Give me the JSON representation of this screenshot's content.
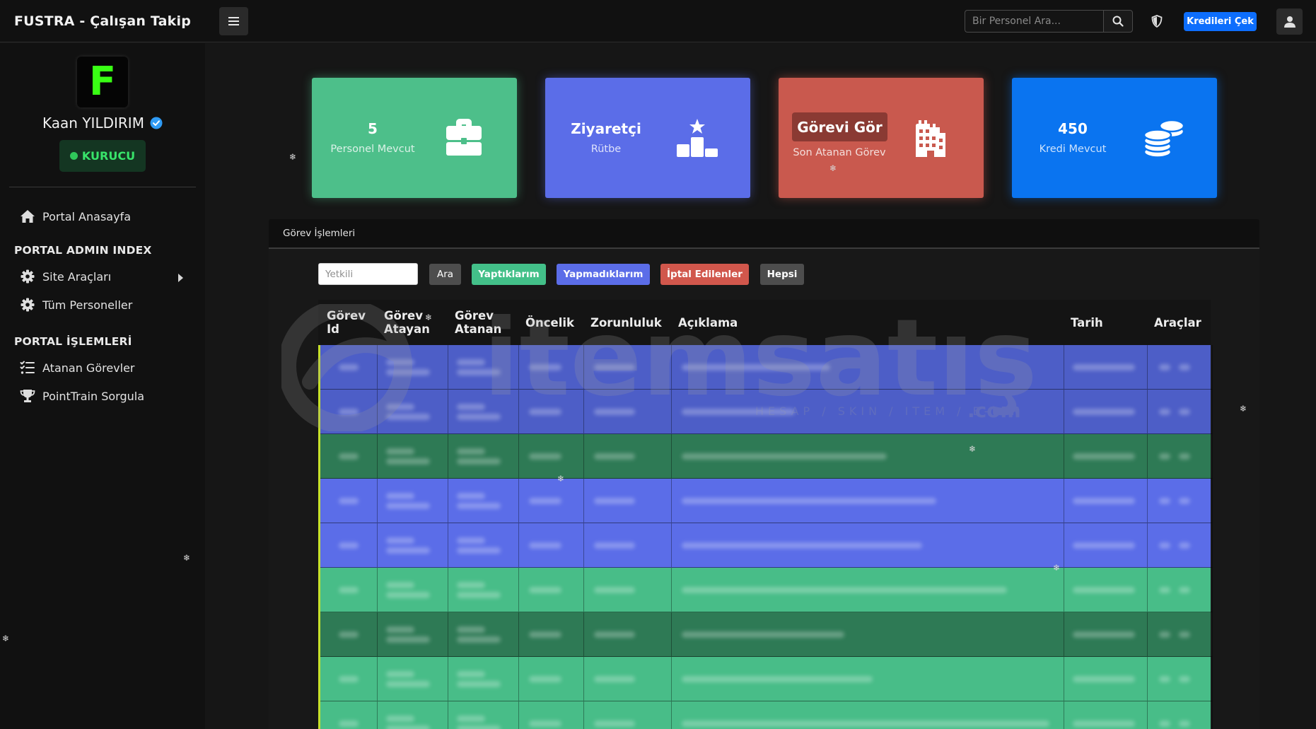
{
  "app": {
    "title": "FUSTRA - Çalışan Takip"
  },
  "topbar": {
    "search_placeholder": "Bir Personel Ara...",
    "credit_button": "Kredileri Çek",
    "icons": [
      "menu-icon",
      "search-icon",
      "shield-icon",
      "user-icon"
    ]
  },
  "sidebar": {
    "logo_letter": "F",
    "user_name": "Kaan YILDIRIM",
    "role": "KURUCU",
    "items": [
      {
        "label": "Portal Anasayfa",
        "icon": "home-icon"
      },
      {
        "heading": "PORTAL ADMIN INDEX"
      },
      {
        "label": "Site Araçları",
        "icon": "gear-icon"
      },
      {
        "label": "Tüm Personeller",
        "icon": "gear-icon"
      },
      {
        "heading": "PORTAL İŞLEMLERİ"
      },
      {
        "label": "Atanan Görevler",
        "icon": "list-check-icon"
      },
      {
        "label": "PointTrain Sorgula",
        "icon": "trophy-icon"
      }
    ]
  },
  "cards": [
    {
      "value": "5",
      "label": "Personel Mevcut",
      "icon": "briefcase-icon",
      "color": "#4dbf8a"
    },
    {
      "value": "Ziyaretçi",
      "label": "Rütbe",
      "icon": "podium-star-icon",
      "color": "#5b6de8"
    },
    {
      "value": "Görevi Gör",
      "label": "Son Atanan Görev",
      "icon": "building-icon",
      "color": "#c9594e"
    },
    {
      "value": "450",
      "label": "Kredi Mevcut",
      "icon": "coins-icon",
      "color": "#0a74f0"
    }
  ],
  "panel": {
    "title": "Görev İşlemleri",
    "filter_placeholder": "Yetkili",
    "buttons": {
      "search": "Ara",
      "done": "Yaptıklarım",
      "not_done": "Yapmadıklarım",
      "cancelled": "İptal Edilenler",
      "all": "Hepsi"
    },
    "columns": [
      "Görev Id",
      "Görev Atayan",
      "Görev Atanan",
      "Öncelik",
      "Zorunluluk",
      "Açıklama",
      "Tarih",
      "Araçlar"
    ],
    "row_colors": [
      "#4d5ec7",
      "#4d5ec7",
      "#2e7a55",
      "#5b6de8",
      "#5b6de8",
      "#48bd88",
      "#2e7a55",
      "#48bd88",
      "#48bd88"
    ]
  },
  "watermark": {
    "brand": "itemsatış",
    "tagline": "HESAP / SKIN / ITEM / E-PIN",
    "suffix": ".com"
  }
}
